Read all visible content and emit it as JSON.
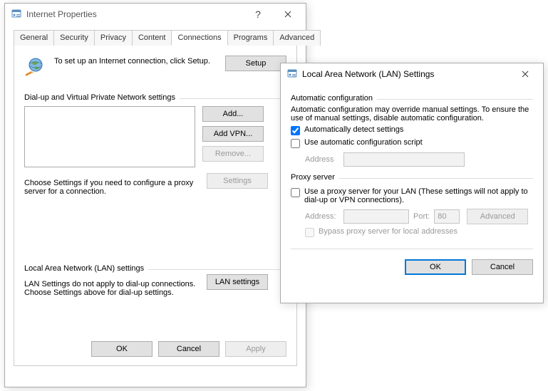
{
  "ip_window": {
    "title": "Internet Properties",
    "tabs": [
      "General",
      "Security",
      "Privacy",
      "Content",
      "Connections",
      "Programs",
      "Advanced"
    ],
    "active_tab": "Connections",
    "setup_text": "To set up an Internet connection, click Setup.",
    "setup_btn": "Setup",
    "dun_header": "Dial-up and Virtual Private Network settings",
    "add_btn": "Add...",
    "addvpn_btn": "Add VPN...",
    "remove_btn": "Remove...",
    "settings_btn": "Settings",
    "choose_text": "Choose Settings if you need to configure a proxy server for a connection.",
    "lan_header": "Local Area Network (LAN) settings",
    "lan_text": "LAN Settings do not apply to dial-up connections. Choose Settings above for dial-up settings.",
    "lan_btn": "LAN settings",
    "ok": "OK",
    "cancel": "Cancel",
    "apply": "Apply"
  },
  "lan_window": {
    "title": "Local Area Network (LAN) Settings",
    "auto_header": "Automatic configuration",
    "auto_desc": "Automatic configuration may override manual settings.  To ensure the use of manual settings, disable automatic configuration.",
    "auto_detect": "Automatically detect settings",
    "auto_detect_checked": true,
    "use_script": "Use automatic configuration script",
    "use_script_checked": false,
    "address_label": "Address",
    "address_value": "",
    "proxy_header": "Proxy server",
    "use_proxy": "Use a proxy server for your LAN (These settings will not apply to dial-up or VPN connections).",
    "use_proxy_checked": false,
    "proxy_addr_label": "Address:",
    "proxy_addr_value": "",
    "proxy_port_label": "Port:",
    "proxy_port_value": "80",
    "advanced_btn": "Advanced",
    "bypass": "Bypass proxy server for local addresses",
    "bypass_checked": false,
    "ok": "OK",
    "cancel": "Cancel"
  }
}
